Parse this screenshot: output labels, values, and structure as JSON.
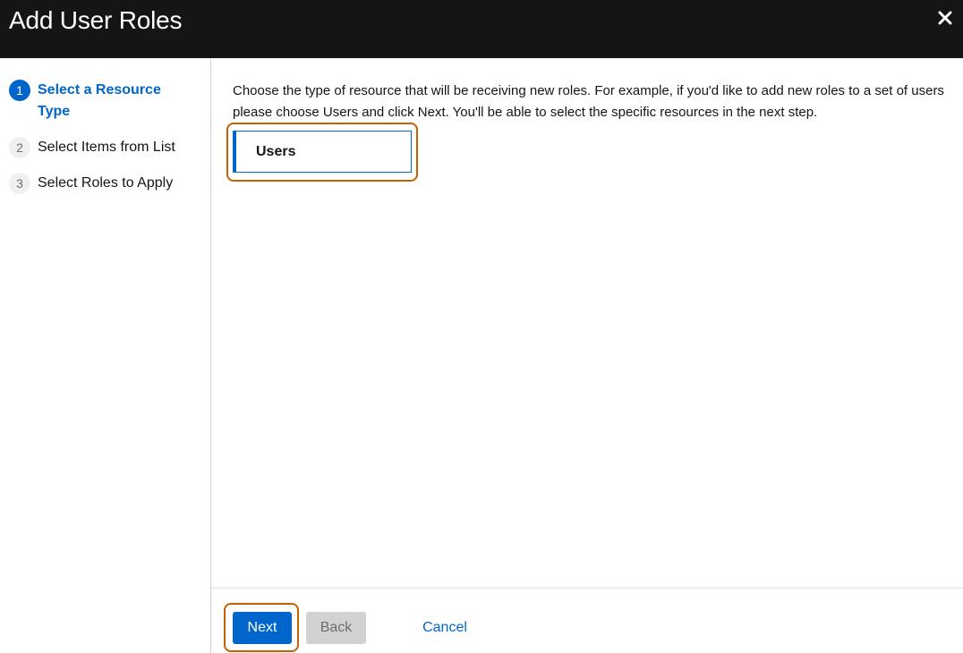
{
  "header": {
    "title": "Add User Roles",
    "close_icon": "close-icon",
    "background": "#151515"
  },
  "wizard": {
    "steps": [
      {
        "number": "1",
        "label": "Select a Resource Type",
        "active": true
      },
      {
        "number": "2",
        "label": "Select Items from List",
        "active": false
      },
      {
        "number": "3",
        "label": "Select Roles to Apply",
        "active": false
      }
    ]
  },
  "main": {
    "description": "Choose the type of resource that will be receiving new roles. For example, if you'd like to add new roles to a set of users please choose Users and click Next. You'll be able to select the specific resources in the next step.",
    "resource_option": "Users"
  },
  "footer": {
    "next_label": "Next",
    "back_label": "Back",
    "cancel_label": "Cancel"
  },
  "colors": {
    "accent": "#0066cc",
    "highlight": "#c46100",
    "disabled": "#d2d2d2"
  }
}
